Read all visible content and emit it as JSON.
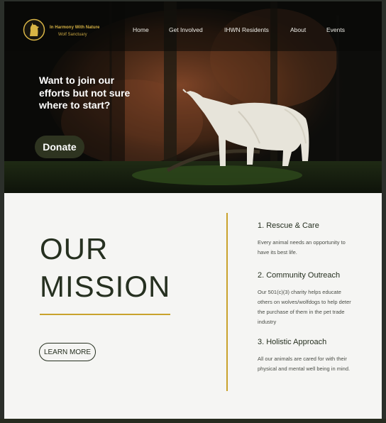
{
  "brand": {
    "name": "In Harmony With Nature",
    "sub": "Wolf Sanctuary"
  },
  "nav": [
    "Home",
    "Get Involved",
    "IHWN Residents",
    "About",
    "Events"
  ],
  "hero": {
    "heading": "Want to join our efforts but not sure where to start?",
    "cta": "Donate"
  },
  "mission": {
    "title_line1": "OUR",
    "title_line2": "MISSION",
    "button": "LEARN MORE",
    "items": [
      {
        "title": "1. Rescue & Care",
        "text": "Every animal needs an opportunity to have its best life."
      },
      {
        "title": "2. Community Outreach",
        "text": "Our 501(c)(3) charity helps educate others on wolves/wolfdogs to help deter the purchase of them in the pet trade industry"
      },
      {
        "title": "3. Holistic Approach",
        "text": "All our animals are cared for with their physical and mental well being in mind."
      }
    ]
  },
  "colors": {
    "accent_gold": "#c9a22c",
    "dark_green": "#263020",
    "donate_bg": "#2e3420",
    "page_bg": "#f5f5f3"
  },
  "icons": {
    "logo": "howling-wolf-logo-icon"
  }
}
